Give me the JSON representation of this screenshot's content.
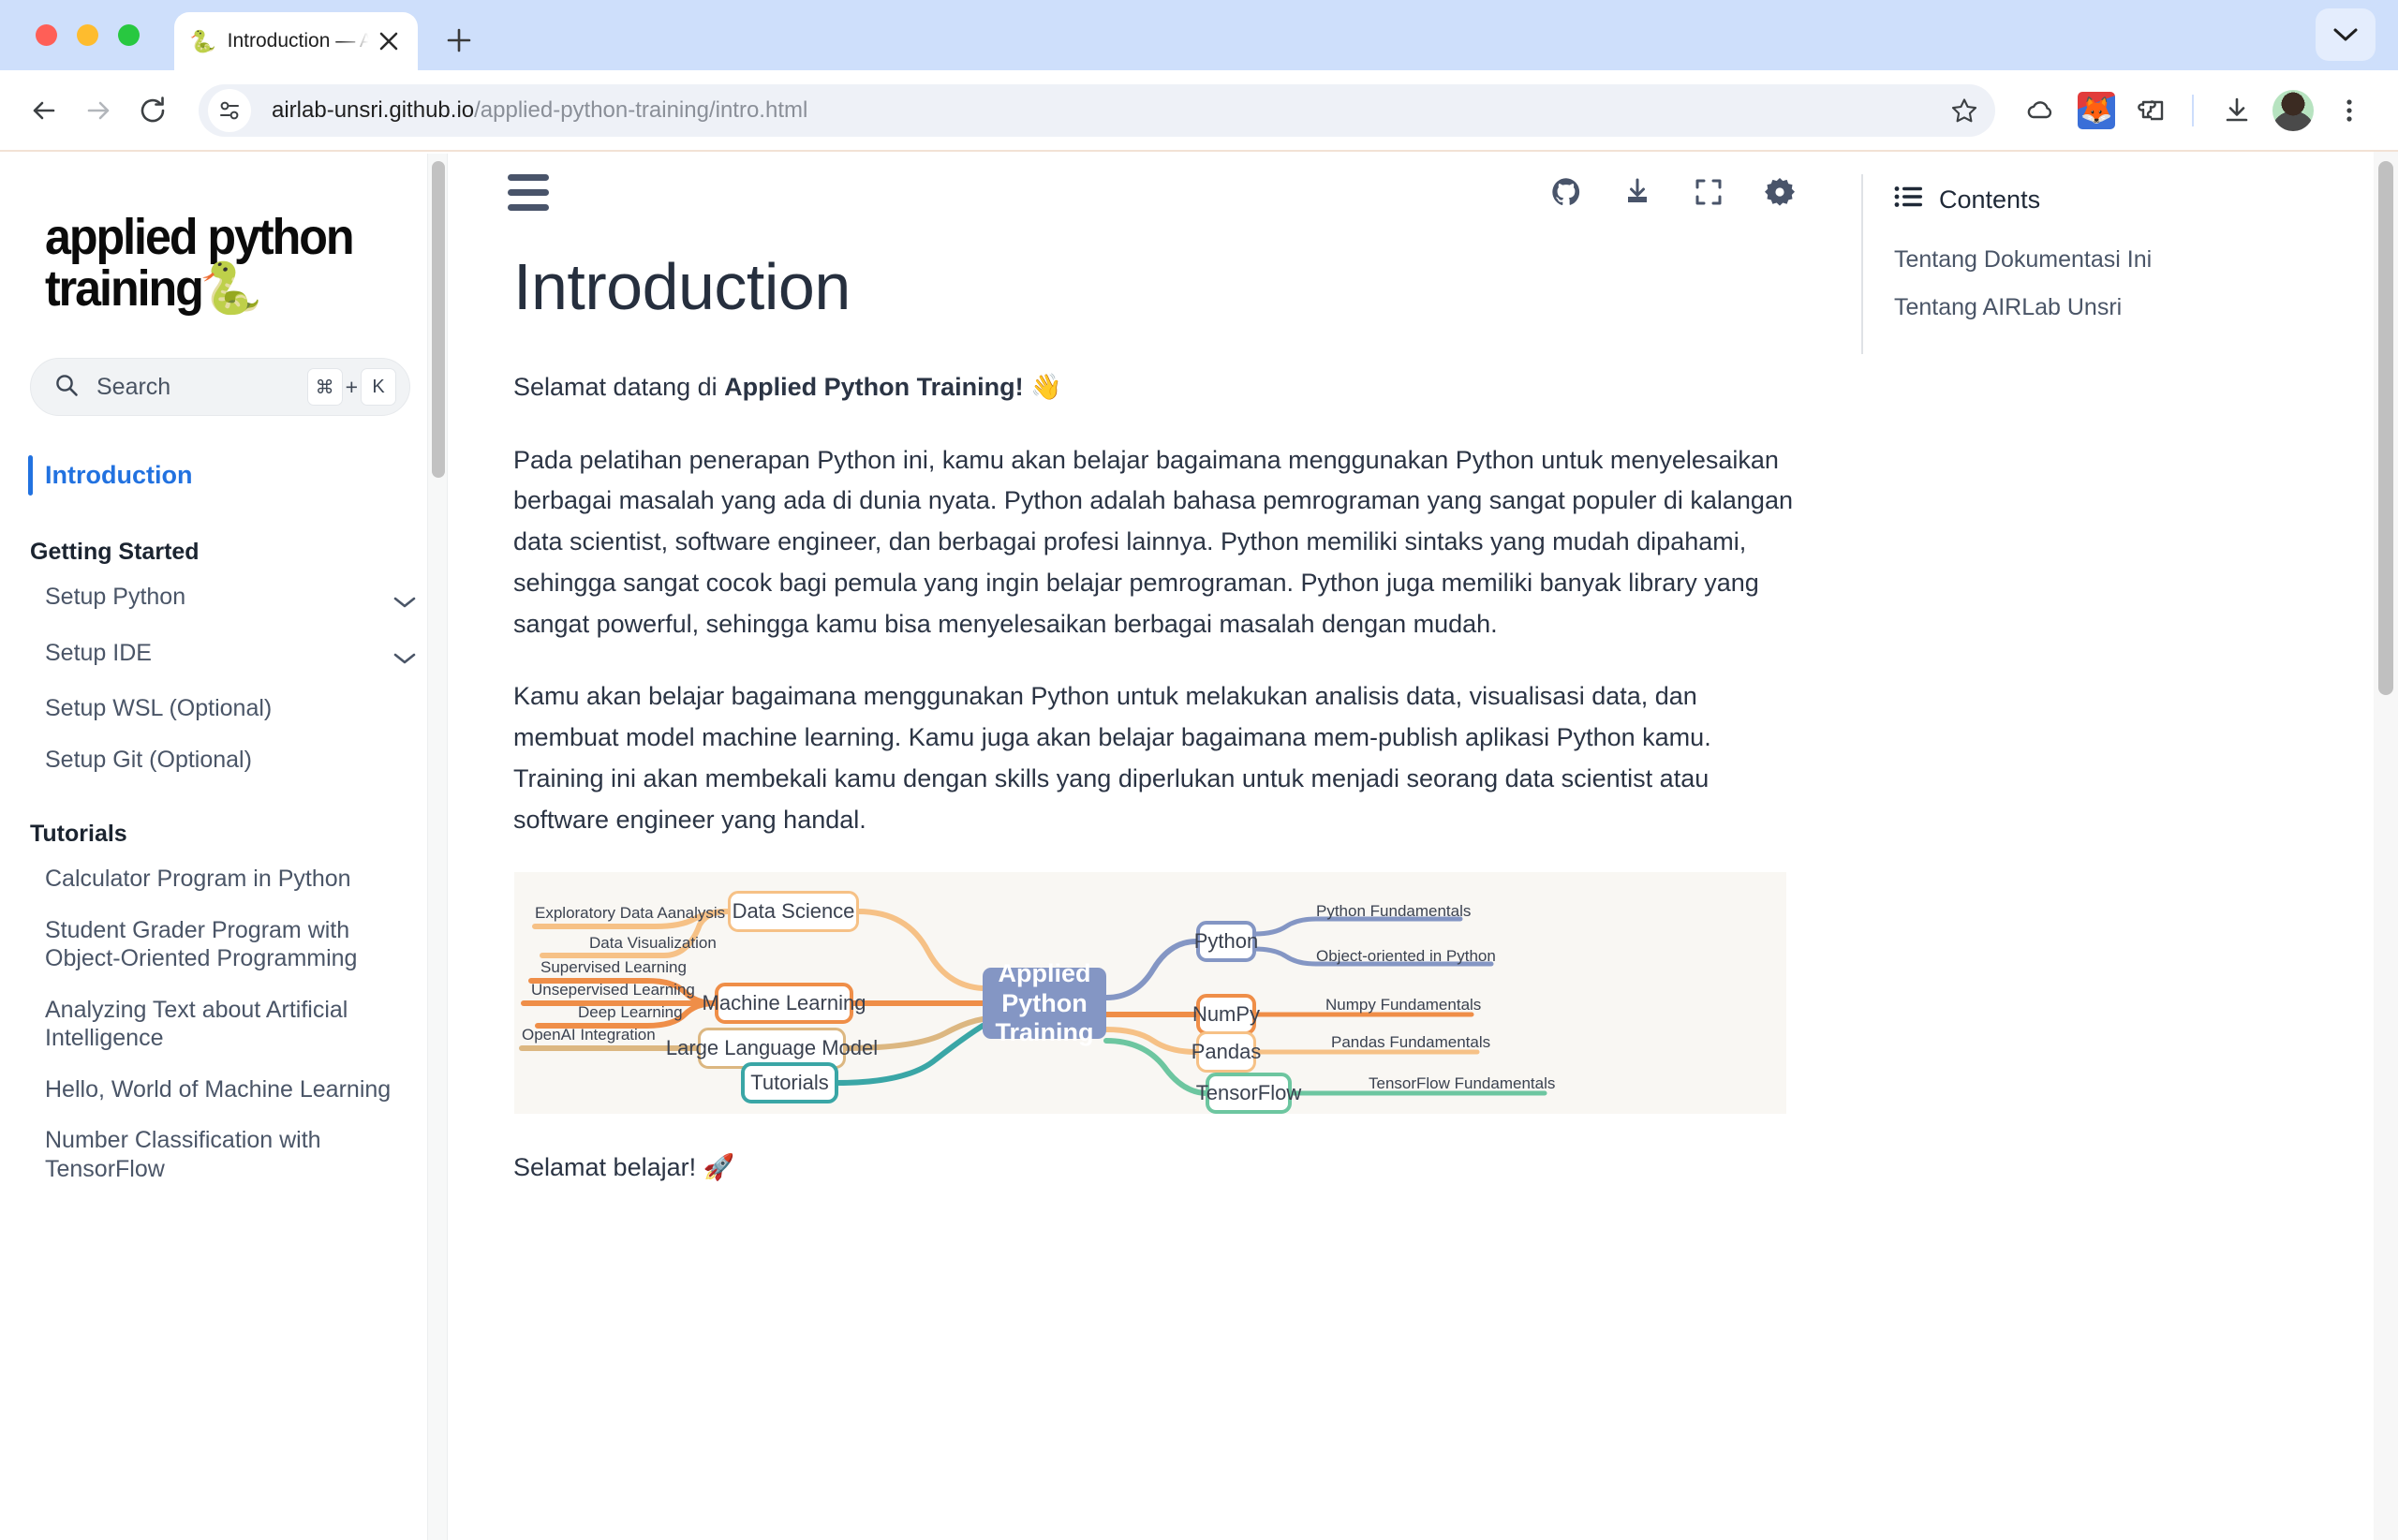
{
  "browser": {
    "tab": {
      "favicon": "snake-emoji",
      "title": "Introduction — Applied Python Training",
      "close_label": "✕"
    },
    "new_tab_label": "+",
    "tabstrip_chevron_label": "⌄",
    "nav": {
      "back_label": "←",
      "forward_label": "→",
      "reload_label": "⟳"
    },
    "omnibox": {
      "site_icon": "tune-icon",
      "url_host": "airlab-unsri.github.io",
      "url_path": "/applied-python-training/intro.html",
      "url_full": "airlab-unsri.github.io/applied-python-training/intro.html"
    },
    "toolbar_icons": [
      {
        "name": "bookmark-star-icon"
      },
      {
        "name": "cloud-icon"
      },
      {
        "name": "fox-extension-icon"
      },
      {
        "name": "extensions-puzzle-icon"
      },
      {
        "name": "downloads-icon"
      },
      {
        "name": "profile-avatar"
      },
      {
        "name": "chrome-menu-icon"
      }
    ]
  },
  "sidebar": {
    "logo_line1": "applied python",
    "logo_line2": "training",
    "logo_emoji": "🐍",
    "search": {
      "placeholder": "Search",
      "kbd_mod": "⌘",
      "kbd_plus": "+",
      "kbd_key": "K"
    },
    "current_item": "Introduction",
    "sections": [
      {
        "heading": "Getting Started",
        "items": [
          {
            "label": "Setup Python",
            "expandable": true
          },
          {
            "label": "Setup IDE",
            "expandable": true
          },
          {
            "label": "Setup WSL (Optional)",
            "expandable": false
          },
          {
            "label": "Setup Git (Optional)",
            "expandable": false
          }
        ]
      },
      {
        "heading": "Tutorials",
        "items": [
          {
            "label": "Calculator Program in Python",
            "expandable": false
          },
          {
            "label": "Student Grader Program with Object-Oriented Programming",
            "expandable": false
          },
          {
            "label": "Analyzing Text about Artificial Intelligence",
            "expandable": false
          },
          {
            "label": "Hello, World of Machine Learning",
            "expandable": false
          },
          {
            "label": "Number Classification with TensorFlow",
            "expandable": false
          }
        ]
      }
    ]
  },
  "main": {
    "burger_label": "menu-icon",
    "toolbar_icons": [
      {
        "name": "github-icon"
      },
      {
        "name": "download-icon"
      },
      {
        "name": "fullscreen-icon"
      },
      {
        "name": "settings-gear-icon"
      }
    ],
    "title": "Introduction",
    "paragraph_welcome_pre": "Selamat datang di ",
    "paragraph_welcome_bold": "Applied Python Training!",
    "paragraph_welcome_emoji": " 👋",
    "paragraph_1": "Pada pelatihan penerapan Python ini, kamu akan belajar bagaimana menggunakan Python untuk menyelesaikan berbagai masalah yang ada di dunia nyata. Python adalah bahasa pemrograman yang sangat populer di kalangan data scientist, software engineer, dan berbagai profesi lainnya. Python memiliki sintaks yang mudah dipahami, sehingga sangat cocok bagi pemula yang ingin belajar pemrograman. Python juga memiliki banyak library yang sangat powerful, sehingga kamu bisa menyelesaikan berbagai masalah dengan mudah.",
    "paragraph_2": "Kamu akan belajar bagaimana menggunakan Python untuk melakukan analisis data, visualisasi data, dan membuat model machine learning. Kamu juga akan belajar bagaimana mem-publish aplikasi Python kamu. Training ini akan membekali kamu dengan skills yang diperlukan untuk menjadi seorang data scientist atau software engineer yang handal.",
    "closing": "Selamat belajar! 🚀"
  },
  "mindmap": {
    "background": "#f9f7f3",
    "center": "Applied Python Training",
    "center_color": "#8496c4",
    "branches": [
      {
        "label": "Data Science",
        "color": "#f6c186",
        "side": "left",
        "leaves": [
          "Exploratory Data Aanalysis",
          "Data Visualization"
        ]
      },
      {
        "label": "Machine Learning",
        "color": "#ef8e48",
        "side": "left",
        "leaves": [
          "Supervised Learning",
          "Unsepervised Learning",
          "Deep Learning"
        ]
      },
      {
        "label": "Large Language Model",
        "color": "#dcb781",
        "side": "left",
        "leaves": [
          "OpenAI Integration"
        ]
      },
      {
        "label": "Tutorials",
        "color": "#3aa6a6",
        "side": "left",
        "leaves": []
      },
      {
        "label": "Python",
        "color": "#8496c4",
        "side": "right",
        "leaves": [
          "Python Fundamentals",
          "Object-oriented in Python"
        ]
      },
      {
        "label": "NumPy",
        "color": "#ef8e48",
        "side": "right",
        "leaves": [
          "Numpy Fundamentals"
        ]
      },
      {
        "label": "Pandas",
        "color": "#f6c186",
        "side": "right",
        "leaves": [
          "Pandas Fundamentals"
        ]
      },
      {
        "label": "TensorFlow",
        "color": "#6dc6a0",
        "side": "right",
        "leaves": [
          "TensorFlow Fundamentals"
        ]
      }
    ]
  },
  "contents": {
    "heading": "Contents",
    "icon": "list-icon",
    "links": [
      "Tentang Dokumentasi Ini",
      "Tentang AIRLab Unsri"
    ]
  }
}
